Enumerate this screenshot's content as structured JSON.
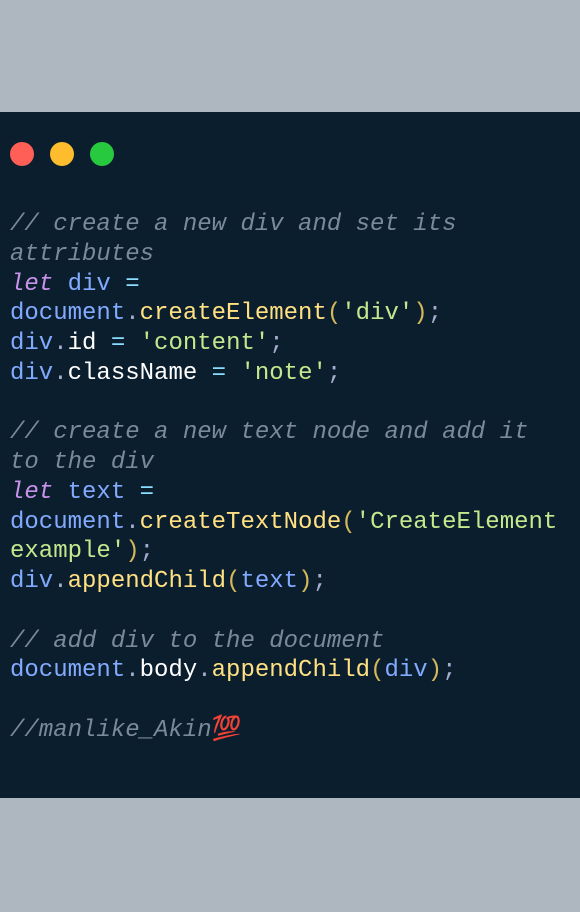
{
  "colors": {
    "page_bg": "#aeb7c0",
    "window_bg": "#0b1e2d",
    "red": "#ff5f56",
    "yellow": "#ffbd2e",
    "green": "#27c93f",
    "comment": "#7a8a99",
    "keyword": "#c792ea",
    "variable": "#82aaff",
    "operator": "#89ddff",
    "function": "#ffe082",
    "property": "#ffffff",
    "bracket": "#d4b95a",
    "string": "#c3e88d"
  },
  "code": {
    "c1": "// create a new div and set its attributes",
    "l1": {
      "kw": "let",
      "sp1": " ",
      "vr": "div",
      "sp2": " ",
      "op": "=",
      "sp3": " ",
      "obj": "document",
      "dot": ".",
      "fn": "createElement",
      "lb": "(",
      "str": "'div'",
      "rb": ")",
      "sc": ";"
    },
    "l2": {
      "vr": "div",
      "dot": ".",
      "pr": "id",
      "sp1": " ",
      "op": "=",
      "sp2": " ",
      "str": "'content'",
      "sc": ";"
    },
    "l3": {
      "vr": "div",
      "dot": ".",
      "pr": "className",
      "sp1": " ",
      "op": "=",
      "sp2": " ",
      "str": "'note'",
      "sc": ";"
    },
    "c2": "// create a new text node and add it to the div",
    "l4": {
      "kw": "let",
      "sp1": " ",
      "vr": "text",
      "sp2": " ",
      "op": "=",
      "sp3": " ",
      "obj": "document",
      "dot": ".",
      "fn": "createTextNode",
      "lb": "(",
      "str": "'CreateElement example'",
      "rb": ")",
      "sc": ";"
    },
    "l5": {
      "vr": "div",
      "dot": ".",
      "fn": "appendChild",
      "lb": "(",
      "arg": "text",
      "rb": ")",
      "sc": ";"
    },
    "c3": "// add div to the document",
    "l6": {
      "obj": "document",
      "dot1": ".",
      "pr": "body",
      "dot2": ".",
      "fn": "appendChild",
      "lb": "(",
      "arg": "div",
      "rb": ")",
      "sc": ";"
    },
    "c4a": "//manlike_Akin",
    "c4b": "💯"
  }
}
